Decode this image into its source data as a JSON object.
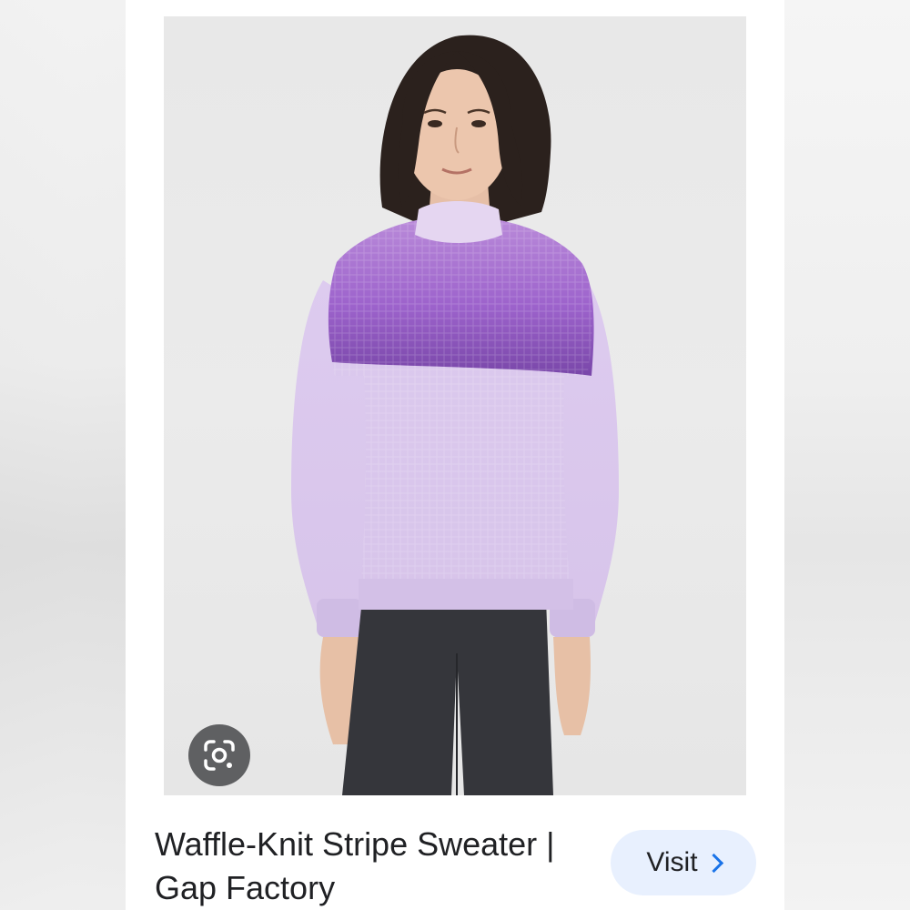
{
  "result": {
    "title_line1": "Waffle-Knit Stripe Sweater |",
    "title_line2": "Gap Factory",
    "visit_label": "Visit",
    "visit_icon": "chevron-right-icon",
    "lens_icon": "google-lens-icon"
  },
  "colors": {
    "visit_bg": "#e8f0fe",
    "visit_chevron": "#1a73e8",
    "lens_bg": "#5f6062",
    "sweater_light": "#dcc8ec",
    "sweater_mid": "#a46bd2",
    "sweater_dark": "#7a48aa",
    "jeans": "#35363b"
  }
}
